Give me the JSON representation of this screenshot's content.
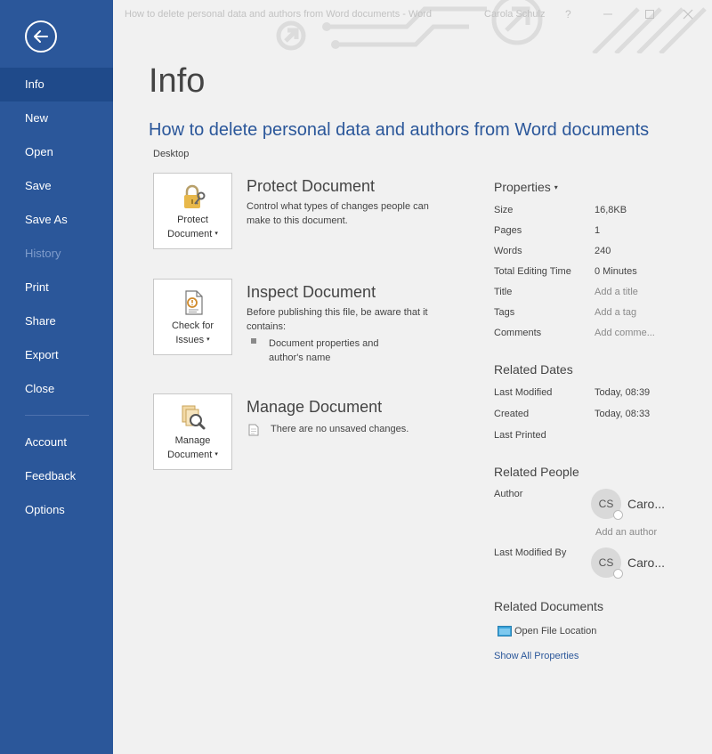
{
  "window": {
    "title": "How to delete personal data and authors from Word documents - Word",
    "user": "Carola Schulz",
    "help": "?"
  },
  "sidebar": {
    "items": [
      {
        "label": "Info"
      },
      {
        "label": "New"
      },
      {
        "label": "Open"
      },
      {
        "label": "Save"
      },
      {
        "label": "Save As"
      },
      {
        "label": "History"
      },
      {
        "label": "Print"
      },
      {
        "label": "Share"
      },
      {
        "label": "Export"
      },
      {
        "label": "Close"
      },
      {
        "label": "Account"
      },
      {
        "label": "Feedback"
      },
      {
        "label": "Options"
      }
    ]
  },
  "main": {
    "page_title": "Info",
    "doc_title": "How to delete personal data and authors from Word documents",
    "location": "Desktop",
    "protect": {
      "button_line1": "Protect",
      "button_line2": "Document",
      "caret": "▾",
      "title": "Protect Document",
      "desc": "Control what types of changes people can make to this document."
    },
    "inspect": {
      "button_line1": "Check for",
      "button_line2": "Issues",
      "caret": "▾",
      "title": "Inspect Document",
      "desc": "Before publishing this file, be aware that it contains:",
      "bullet": "Document properties and author's name"
    },
    "manage": {
      "button_line1": "Manage",
      "button_line2": "Document",
      "caret": "▾",
      "title": "Manage Document",
      "desc": "There are no unsaved changes."
    }
  },
  "properties": {
    "heading": "Properties",
    "caret": "▾",
    "size_label": "Size",
    "size_value": "16,8KB",
    "pages_label": "Pages",
    "pages_value": "1",
    "words_label": "Words",
    "words_value": "240",
    "editing_label": "Total Editing Time",
    "editing_value": "0 Minutes",
    "title_label": "Title",
    "title_value": "Add a title",
    "tags_label": "Tags",
    "tags_value": "Add a tag",
    "comments_label": "Comments",
    "comments_value": "Add comme..."
  },
  "dates": {
    "heading": "Related Dates",
    "modified_label": "Last Modified",
    "modified_value": "Today, 08:39",
    "created_label": "Created",
    "created_value": "Today, 08:33",
    "printed_label": "Last Printed"
  },
  "people": {
    "heading": "Related People",
    "author_label": "Author",
    "author_initials": "CS",
    "author_name": "Caro...",
    "add_author": "Add an author",
    "modified_by_label": "Last Modified By",
    "modified_initials": "CS",
    "modified_name": "Caro..."
  },
  "documents": {
    "heading": "Related Documents",
    "open_location": "Open File Location",
    "show_all": "Show All Properties"
  },
  "colors": {
    "accent": "#2b579a",
    "sidebar_active": "#1f4a8a",
    "background": "#f1f1f1"
  }
}
